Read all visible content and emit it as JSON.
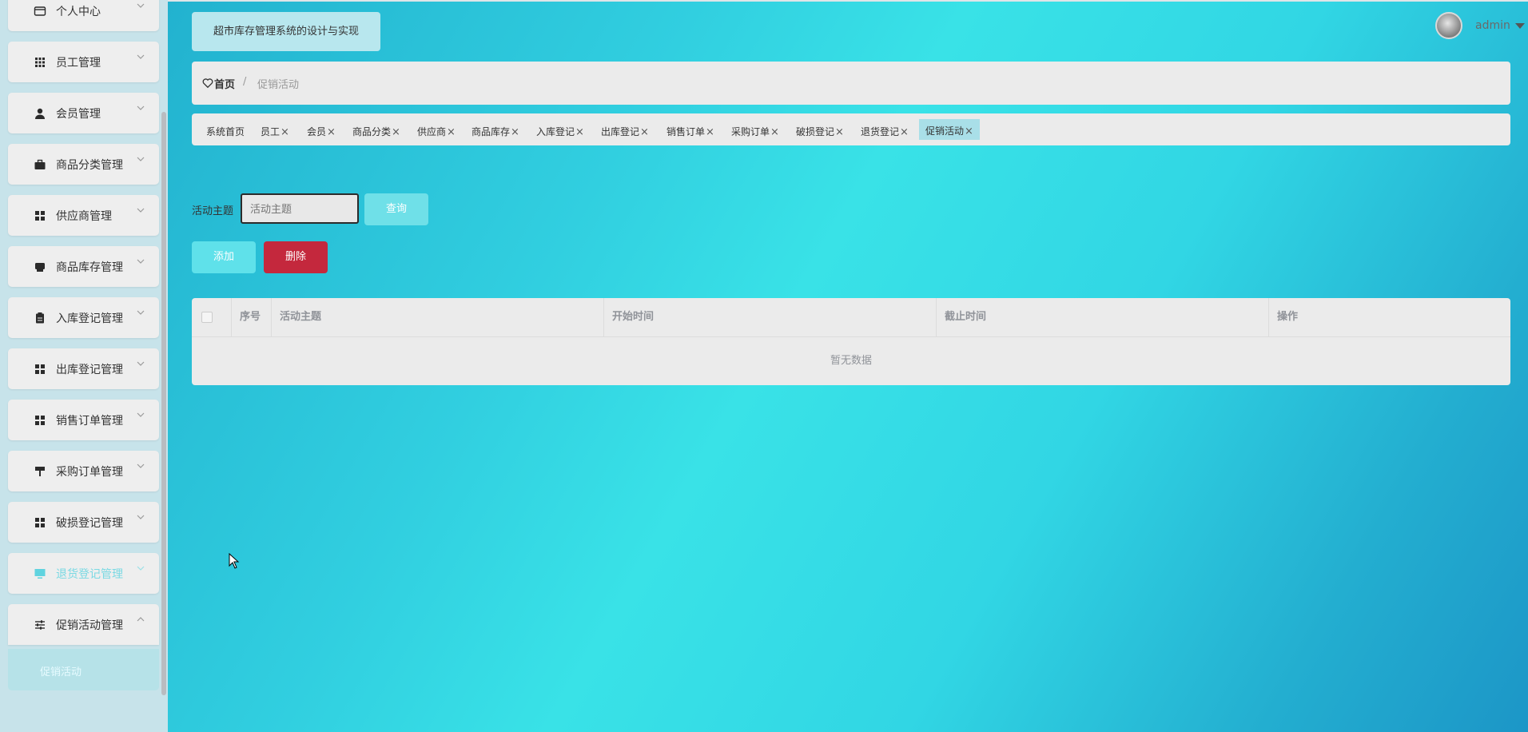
{
  "sidebar": {
    "items": [
      {
        "label": "个人中心",
        "icon": "profile-card-icon"
      },
      {
        "label": "员工管理",
        "icon": "grid-icon"
      },
      {
        "label": "会员管理",
        "icon": "user-icon"
      },
      {
        "label": "商品分类管理",
        "icon": "briefcase-icon"
      },
      {
        "label": "供应商管理",
        "icon": "apps-icon"
      },
      {
        "label": "商品库存管理",
        "icon": "printer-icon"
      },
      {
        "label": "入库登记管理",
        "icon": "clipboard-icon"
      },
      {
        "label": "出库登记管理",
        "icon": "apps-icon"
      },
      {
        "label": "销售订单管理",
        "icon": "apps-icon"
      },
      {
        "label": "采购订单管理",
        "icon": "paint-roller-icon"
      },
      {
        "label": "破损登记管理",
        "icon": "apps-icon"
      },
      {
        "label": "退货登记管理",
        "icon": "monitor-icon"
      },
      {
        "label": "促销活动管理",
        "icon": "sliders-icon"
      }
    ],
    "submenu": {
      "label": "促销活动"
    }
  },
  "header": {
    "title": "超市库存管理系统的设计与实现",
    "user": {
      "name": "admin"
    }
  },
  "breadcrumb": {
    "home": "首页",
    "separator": "/",
    "current": "促销活动"
  },
  "tags": [
    {
      "label": "系统首页",
      "closable": false
    },
    {
      "label": "员工",
      "closable": true
    },
    {
      "label": "会员",
      "closable": true
    },
    {
      "label": "商品分类",
      "closable": true
    },
    {
      "label": "供应商",
      "closable": true
    },
    {
      "label": "商品库存",
      "closable": true
    },
    {
      "label": "入库登记",
      "closable": true
    },
    {
      "label": "出库登记",
      "closable": true
    },
    {
      "label": "销售订单",
      "closable": true
    },
    {
      "label": "采购订单",
      "closable": true
    },
    {
      "label": "破损登记",
      "closable": true
    },
    {
      "label": "退货登记",
      "closable": true
    },
    {
      "label": "促销活动",
      "closable": true,
      "active": true
    }
  ],
  "search": {
    "label": "活动主题",
    "placeholder": "活动主题",
    "button": "查询"
  },
  "actions": {
    "add": "添加",
    "delete": "删除"
  },
  "table": {
    "columns": [
      "序号",
      "活动主题",
      "开始时间",
      "截止时间",
      "操作"
    ],
    "empty_text": "暂无数据"
  },
  "colors": {
    "accent": "#5fe1ea",
    "danger": "#c4283d",
    "card": "#ebebeb"
  }
}
